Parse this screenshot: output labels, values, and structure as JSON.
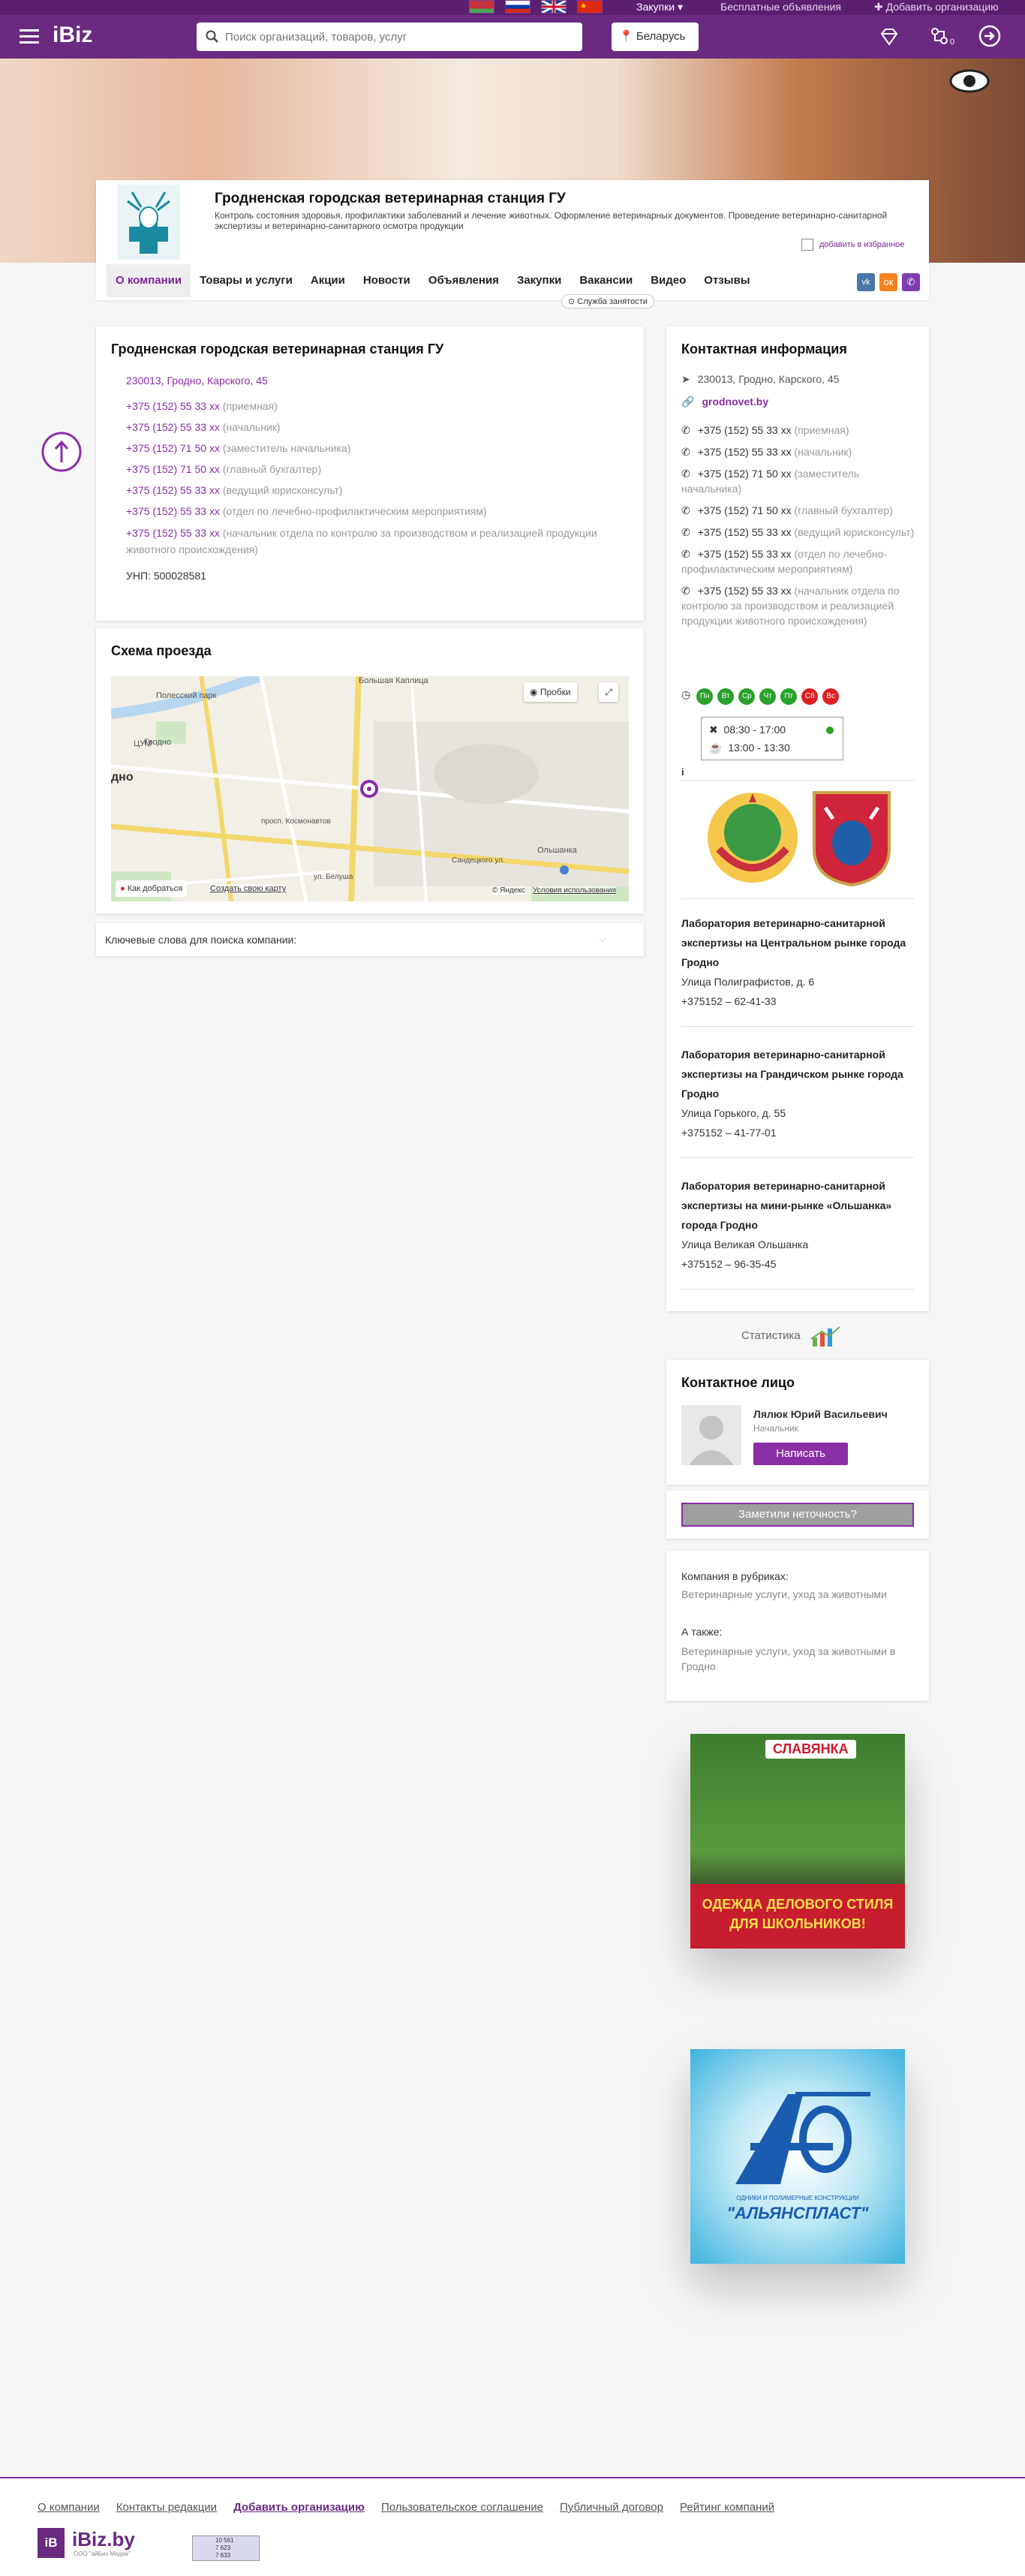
{
  "top": {
    "languages": [
      "by-flag",
      "ru-flag",
      "en-flag",
      "cn-flag"
    ],
    "purchases": "Закупки",
    "free_ads": "Бесплатные объявления",
    "add_org": "Добавить организацию"
  },
  "header": {
    "logo": "iBiz",
    "search_placeholder": "Поиск организаций, товаров, услуг",
    "region": "Беларусь",
    "compare_count": "0"
  },
  "company": {
    "name": "Гродненская городская ветеринарная станция ГУ",
    "description": "Контроль состояния здоровья, профилактики заболеваний и лечение животных. Оформление ветеринарных документов. Проведение ветеринарно-санитарной экспертизы и ветеринарно-санитарного осмотра продукции",
    "favorite": "добавить в избранное",
    "employment_badge": "Служба занятости"
  },
  "tabs": [
    "О компании",
    "Товары и услуги",
    "Акции",
    "Новости",
    "Объявления",
    "Закупки",
    "Вакансии",
    "Видео",
    "Отзывы"
  ],
  "main": {
    "title": "Гродненская городская ветеринарная станция ГУ",
    "address": "230013, Гродно, Карского, 45",
    "phones": [
      {
        "num": "+375 (152) 55 33 xx",
        "note": "(приемная)"
      },
      {
        "num": "+375 (152) 55 33 xx",
        "note": "(начальник)"
      },
      {
        "num": "+375 (152) 71 50 xx",
        "note": "(заместитель начальника)"
      },
      {
        "num": "+375 (152) 71 50 xx",
        "note": "(главный бухгалтер)"
      },
      {
        "num": "+375 (152) 55 33 xx",
        "note": "(ведущий юрисконсульт)"
      },
      {
        "num": "+375 (152) 55 33 xx",
        "note": "(отдел по лечебно-профилактическим мероприятиям)"
      },
      {
        "num": "+375 (152) 55 33 xx",
        "note": "(начальник отдела по контролю за производством и реализацией продукции животного происхождения)"
      }
    ],
    "unp": "УНП: 500028581"
  },
  "map": {
    "title": "Схема проезда",
    "traffic": "Пробки",
    "route": "Как добраться",
    "create_map": "Создать свою карту",
    "yandex": "© Яндекс",
    "terms": "Условия использования",
    "labels": [
      "Большая Каплица",
      "Полесский парк",
      "Гродно",
      "ЦУМ",
      "дно",
      "Ольшанка",
      "Сандецкого ул.",
      "просп. Космонавтов",
      "ул. Белуша"
    ]
  },
  "keywords": {
    "label": "Ключевые слова для поиска компании:"
  },
  "contacts": {
    "title": "Контактная информация",
    "address": "230013, Гродно, Карского, 45",
    "site": "grodnovet.by",
    "phones": [
      {
        "num": "+375 (152) 55 33 xx",
        "note": "(приемная)"
      },
      {
        "num": "+375 (152) 55 33 xx",
        "note": "(начальник)"
      },
      {
        "num": "+375 (152) 71 50 xx",
        "note": "(заместитель начальника)"
      },
      {
        "num": "+375 (152) 71 50 xx",
        "note": "(главный бухгалтер)"
      },
      {
        "num": "+375 (152) 55 33 xx",
        "note": "(ведущий юрисконсульт)"
      },
      {
        "num": "+375 (152) 55 33 xx",
        "note": "(отдел по лечебно-профилактическим мероприятиям)"
      },
      {
        "num": "+375 (152) 55 33 xx",
        "note": "(начальник отдела по контролю за производством и реализацией продукции животного происхождения)"
      }
    ],
    "days": [
      "Пн",
      "Вт",
      "Ср",
      "Чт",
      "Пт",
      "Сб",
      "Вс"
    ],
    "work_hours": "08:30 - 17:00",
    "lunch_hours": "13:00 - 13:30",
    "info_mark": "i"
  },
  "labs": [
    {
      "title": "Лаборатория ветеринарно-санитарной экспертизы на Центральном рынке города Гродно",
      "street": "Улица Полиграфистов, д. 6",
      "phone": "+375152 – 62-41-33"
    },
    {
      "title": "Лаборатория ветеринарно-санитарной экспертизы на Грандичском рынке города Гродно",
      "street": "Улица Горького, д. 55",
      "phone": "+375152 – 41-77-01"
    },
    {
      "title": "Лаборатория ветеринарно-санитарной экспертизы на мини-рынке «Ольшанка» города Гродно",
      "street": "Улица Великая Ольшанка",
      "phone": "+375152 – 96-35-45"
    }
  ],
  "stats": "Статистика",
  "person": {
    "title": "Контактное лицо",
    "name": "Лялюк Юрий Васильевич",
    "position": "Начальник",
    "write": "Написать"
  },
  "report": "Заметили неточность?",
  "rubrics": {
    "title": "Компания в рубриках:",
    "value": "Ветеринарные услуги, уход за животными",
    "also_title": "А также:",
    "also_value": "Ветеринарные услуги, уход за животными в Гродно"
  },
  "ads": [
    {
      "brand": "СЛАВЯНКА",
      "text": "ОДЕЖДА ДЕЛОВОГО СТИЛЯ ДЛЯ ШКОЛЬНИКОВ!"
    },
    {
      "brand": "\"АЛЬЯНСПЛАСТ\"",
      "sub": "ОДНИКИ И ПОЛИМЕРНЫЕ КОНСТРУКЦИИ"
    }
  ],
  "footer": {
    "links": [
      "О компании",
      "Контакты редакции",
      "Добавить организацию",
      "Пользовательское соглашение",
      "Публичный договор",
      "Рейтинг компаний"
    ],
    "logo": "iBiz.by",
    "tagline": "ООО \"айБиз Медиа\"",
    "counter": [
      "10 561",
      "7 623",
      "7 633"
    ]
  },
  "colors": {
    "brand": "#6a2a80",
    "accent": "#8a2ea6",
    "open": "#2aa12a",
    "closed": "#e02020"
  }
}
